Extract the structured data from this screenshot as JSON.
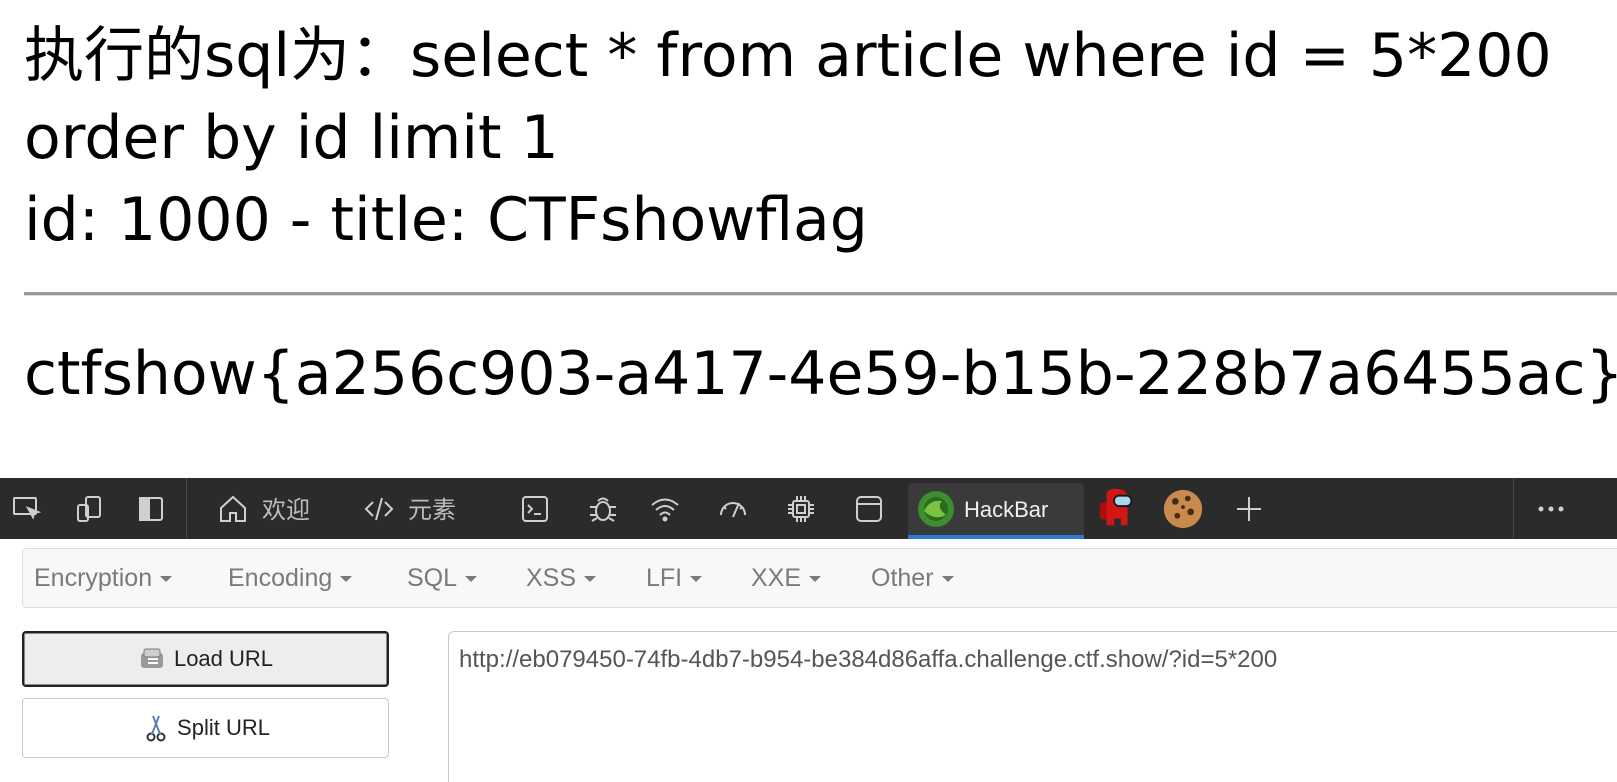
{
  "page": {
    "lines": [
      "执行的sql为：select * from article where id = 5*200",
      "order by id limit 1",
      "id: 1000 - title: CTFshowflag"
    ],
    "flag": "ctfshow{a256c903-a417-4e59-b15b-228b7a6455ac}"
  },
  "devtools": {
    "tabs": {
      "welcome": "欢迎",
      "elements": "元素",
      "hackbar": "HackBar"
    },
    "icons": [
      "inspect-icon",
      "device-emulation-icon",
      "dock-icon",
      "home-icon",
      "code-icon",
      "console-icon",
      "debugger-bug-icon",
      "network-wifi-icon",
      "performance-gauge-icon",
      "memory-chip-icon",
      "application-panel-icon",
      "hackbar-logo-icon",
      "among-us-icon",
      "cookie-icon",
      "plus-icon",
      "more-icon"
    ],
    "accent_color": "#2b7bd7"
  },
  "hackbar": {
    "menu": [
      "Encryption",
      "Encoding",
      "SQL",
      "XSS",
      "LFI",
      "XXE",
      "Other"
    ],
    "load_url_label": "Load URL",
    "split_url_label": "Split URL",
    "url_value": "http://eb079450-74fb-4db7-b954-be384d86affa.challenge.ctf.show/?id=5*200"
  }
}
